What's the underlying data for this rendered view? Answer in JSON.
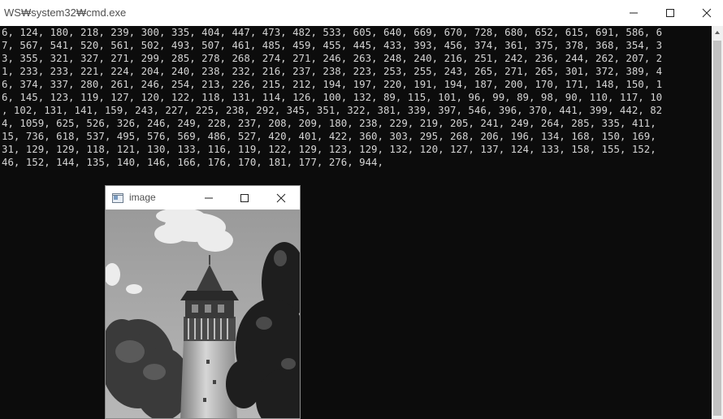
{
  "cmd_window": {
    "title": "WS₩system32₩cmd.exe",
    "minimize_icon": "minimize-icon",
    "maximize_icon": "maximize-icon",
    "close_icon": "close-icon",
    "lines": [
      "6, 124, 180, 218, 239, 300, 335, 404, 447, 473, 482, 533, 605, 640, 669, 670, 728, 680, 652, 615, 691, 586, 6",
      "7, 567, 541, 520, 561, 502, 493, 507, 461, 485, 459, 455, 445, 433, 393, 456, 374, 361, 375, 378, 368, 354, 3",
      "3, 355, 321, 327, 271, 299, 285, 278, 268, 274, 271, 246, 263, 248, 240, 216, 251, 242, 236, 244, 262, 207, 2",
      "1, 233, 233, 221, 224, 204, 240, 238, 232, 216, 237, 238, 223, 253, 255, 243, 265, 271, 265, 301, 372, 389, 4",
      "6, 374, 337, 280, 261, 246, 254, 213, 226, 215, 212, 194, 197, 220, 191, 194, 187, 200, 170, 171, 148, 150, 1",
      "6, 145, 123, 119, 127, 120, 122, 118, 131, 114, 126, 100, 132, 89, 115, 101, 96, 99, 89, 98, 90, 110, 117, 10",
      ", 102, 131, 141, 159, 243, 227, 225, 238, 292, 345, 351, 322, 381, 339, 397, 546, 396, 370, 441, 399, 442, 82",
      "4, 1059, 625, 526, 326, 246, 249, 228, 237, 208, 209, 180, 238, 229, 219, 205, 241, 249, 264, 285, 335, 411,",
      "15, 736, 618, 537, 495, 576, 569, 486, 527, 420, 401, 422, 360, 303, 295, 268, 206, 196, 134, 168, 150, 169,",
      "31, 129, 129, 118, 121, 130, 133, 116, 119, 122, 129, 123, 129, 132, 120, 127, 137, 124, 133, 158, 155, 152,",
      "46, 152, 144, 135, 140, 146, 166, 176, 170, 181, 177, 276, 944,"
    ],
    "scrollbar": {
      "up_icon": "scroll-up-arrow-icon"
    }
  },
  "image_window": {
    "title": "image",
    "app_icon": "window-app-icon",
    "minimize_icon": "minimize-icon",
    "maximize_icon": "maximize-icon",
    "close_icon": "close-icon",
    "content": "grayscale photo of a stone tower with conical roof among trees under cloudy sky"
  }
}
